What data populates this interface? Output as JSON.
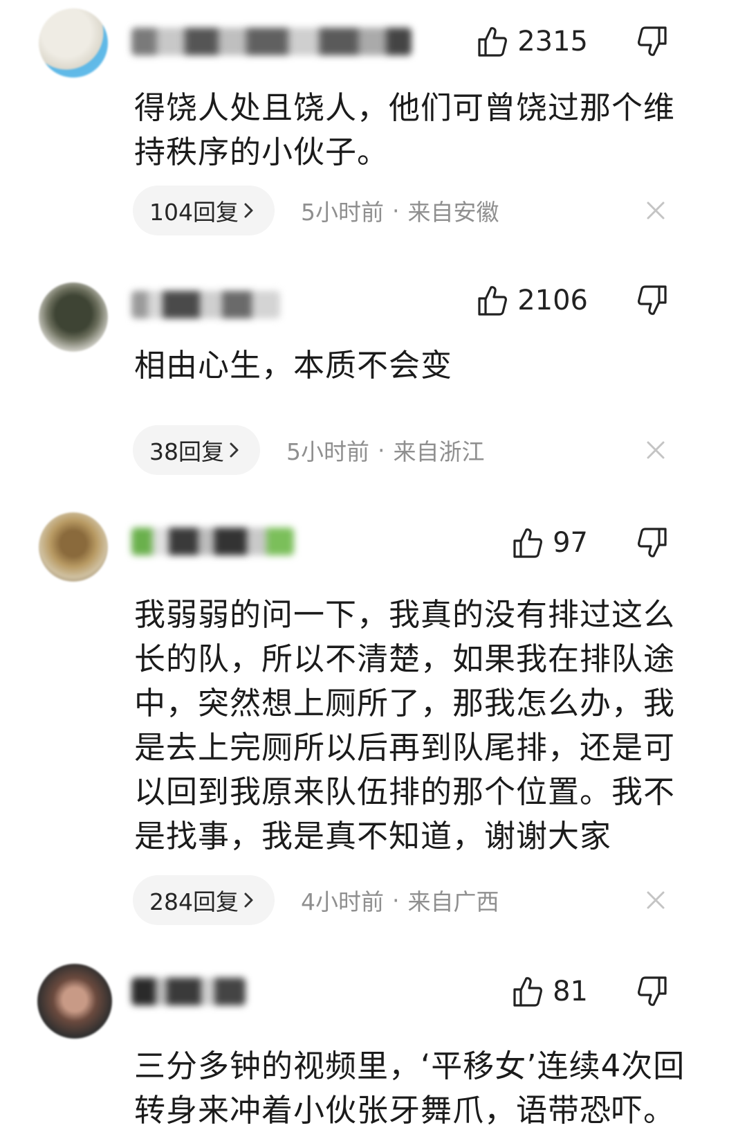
{
  "comments": [
    {
      "likes": "2315",
      "text": "得饶人处且饶人，他们可曾饶过那个维\n持秩序的小伙子。",
      "replies": "104回复",
      "time": "5小时前",
      "location": "来自安徽",
      "dot": "·",
      "avatar_colors": [
        "#e6e3da",
        "#5fb8e6"
      ],
      "name_colors": [
        "#5a5a5a",
        "#bdbdbd"
      ]
    },
    {
      "likes": "2106",
      "text": "相由心生，本质不会变",
      "replies": "38回复",
      "time": "5小时前",
      "location": "来自浙江",
      "dot": "·",
      "avatar_colors": [
        "#4a4f3e",
        "#c9c9c2"
      ],
      "name_colors": [
        "#4a4a4a",
        "#d0d0d0"
      ]
    },
    {
      "likes": "97",
      "text": "我弱弱的问一下，我真的没有排过这么\n长的队，所以不清楚，如果我在排队途\n中，突然想上厕所了，那我怎么办，我\n是去上完厕所以后再到队尾排，还是可\n以回到我原来队伍排的那个位置。我不\n是找事，我是真不知道，谢谢大家",
      "replies": "284回复",
      "time": "4小时前",
      "location": "来自广西",
      "dot": "·",
      "avatar_colors": [
        "#b89a63",
        "#6e5a3c"
      ],
      "name_colors": [
        "#3a3a3a",
        "#6ab04c"
      ]
    },
    {
      "likes": "81",
      "text": "三分多钟的视频里，‘平移女’连续4次回\n转身来冲着小伙张牙舞爪，语带恐吓。",
      "replies": "",
      "time": "",
      "location": "",
      "dot": "",
      "avatar_colors": [
        "#6b4a3e",
        "#2f2f2f"
      ],
      "name_colors": [
        "#2a2a2a",
        "#bdbdbd"
      ]
    }
  ],
  "icons": {
    "like": "thumbs-up-icon",
    "dislike": "thumbs-down-icon",
    "chevron": "chevron-right-icon",
    "close": "close-icon"
  }
}
